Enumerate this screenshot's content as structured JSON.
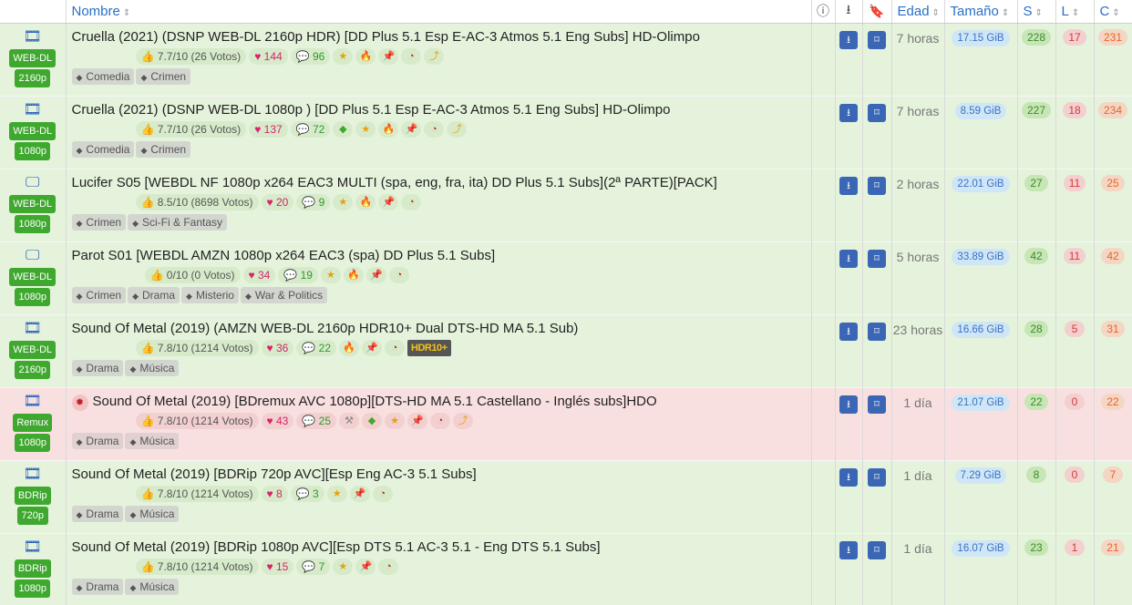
{
  "header": {
    "nombre": "Nombre",
    "edad": "Edad",
    "tamano": "Tamaño",
    "s": "S",
    "l": "L",
    "c": "C",
    "info_icon": "info-icon",
    "download_icon": "download-icon",
    "bookmark_icon": "bookmark-icon",
    "sort_icon": "sort-icon"
  },
  "colors": {
    "row_green": "#e5f3dc",
    "row_red": "#f9e0e0",
    "badge_green": "#3fa82f",
    "button_blue": "#3a66b5",
    "link_blue": "#2a6fc9"
  },
  "rows": [
    {
      "type_icon": "film-icon",
      "badge1": "WEB-DL",
      "badge2": "2160p",
      "title": "Cruella (2021) (DSNP WEB-DL 2160p HDR) [DD Plus 5.1 Esp E-AC-3 Atmos 5.1 Eng Subs] HD-Olimpo",
      "rating": "7.7/10 (26 Votos)",
      "likes": "144",
      "comments": "96",
      "icons": [
        "star-icon",
        "fire-icon",
        "pin-icon",
        "gauge-icon",
        "quick-icon"
      ],
      "tags": [
        "Comedia",
        "Crimen"
      ],
      "age": "7 horas",
      "size": "17.15 GiB",
      "seeders": "228",
      "leechers": "17",
      "completed": "231"
    },
    {
      "type_icon": "film-icon",
      "badge1": "WEB-DL",
      "badge2": "1080p",
      "title": "Cruella (2021) (DSNP WEB-DL 1080p ) [DD Plus 5.1 Esp E-AC-3 Atmos 5.1 Eng Subs] HD-Olimpo",
      "rating": "7.7/10 (26 Votos)",
      "likes": "137",
      "comments": "72",
      "icons": [
        "gem-icon",
        "star-icon",
        "fire-icon",
        "pin-icon",
        "gauge-icon",
        "quick-icon"
      ],
      "tags": [
        "Comedia",
        "Crimen"
      ],
      "age": "7 horas",
      "size": "8.59 GiB",
      "seeders": "227",
      "leechers": "18",
      "completed": "234"
    },
    {
      "type_icon": "tv-icon",
      "badge1": "WEB-DL",
      "badge2": "1080p",
      "title": "Lucifer S05 [WEBDL NF 1080p x264 EAC3 MULTI (spa, eng, fra, ita) DD Plus 5.1 Subs](2ª PARTE)[PACK]",
      "rating": "8.5/10 (8698 Votos)",
      "likes": "20",
      "comments": "9",
      "icons": [
        "star-icon",
        "fire-icon",
        "pin-icon",
        "gauge-icon"
      ],
      "tags": [
        "Crimen",
        "Sci-Fi & Fantasy"
      ],
      "age": "2 horas",
      "size": "22.01 GiB",
      "seeders": "27",
      "leechers": "11",
      "completed": "25"
    },
    {
      "type_icon": "tv-icon",
      "badge1": "WEB-DL",
      "badge2": "1080p",
      "title": "Parot S01 [WEBDL AMZN 1080p x264 EAC3 (spa) DD Plus 5.1 Subs]",
      "rating": "0/10 (0 Votos)",
      "likes": "34",
      "comments": "19",
      "icons": [
        "star-icon",
        "fire-icon",
        "pin-icon",
        "gauge-icon"
      ],
      "tags": [
        "Crimen",
        "Drama",
        "Misterio",
        "War & Politics"
      ],
      "age": "5 horas",
      "size": "33.89 GiB",
      "seeders": "42",
      "leechers": "11",
      "completed": "42"
    },
    {
      "type_icon": "film-icon",
      "badge1": "WEB-DL",
      "badge2": "2160p",
      "title": "Sound Of Metal (2019) (AMZN WEB-DL 2160p HDR10+ Dual DTS-HD MA 5.1 Sub)",
      "rating": "7.8/10 (1214 Votos)",
      "likes": "36",
      "comments": "22",
      "icons": [
        "fire-icon",
        "pin-icon",
        "gauge-icon"
      ],
      "hdr_label": "HDR10+",
      "tags": [
        "Drama",
        "Música"
      ],
      "age": "23 horas",
      "size": "16.66 GiB",
      "seeders": "28",
      "leechers": "5",
      "completed": "31"
    },
    {
      "type_icon": "film-icon",
      "badge1": "Remux",
      "badge2": "1080p",
      "warning_icon": "virus-icon",
      "title": "Sound Of Metal (2019) [BDremux AVC 1080p][DTS-HD MA 5.1 Castellano - Inglés subs]HDO",
      "rating": "7.8/10 (1214 Votos)",
      "likes": "43",
      "comments": "25",
      "icons": [
        "tools-icon",
        "gem-icon",
        "star-icon",
        "pin-icon",
        "gauge-icon",
        "quick-icon"
      ],
      "tags": [
        "Drama",
        "Música"
      ],
      "age": "1 día",
      "size": "21.07 GiB",
      "seeders": "22",
      "leechers": "0",
      "completed": "22"
    },
    {
      "type_icon": "film-icon",
      "badge1": "BDRip",
      "badge2": "720p",
      "title": "Sound Of Metal (2019) [BDRip 720p AVC][Esp Eng AC-3 5.1 Subs]",
      "rating": "7.8/10 (1214 Votos)",
      "likes": "8",
      "comments": "3",
      "icons": [
        "star-icon",
        "pin-icon",
        "gauge-icon"
      ],
      "tags": [
        "Drama",
        "Música"
      ],
      "age": "1 día",
      "size": "7.29 GiB",
      "seeders": "8",
      "leechers": "0",
      "completed": "7"
    },
    {
      "type_icon": "film-icon",
      "badge1": "BDRip",
      "badge2": "1080p",
      "title": "Sound Of Metal (2019) [BDRip 1080p AVC][Esp DTS 5.1 AC-3 5.1 - Eng DTS 5.1 Subs]",
      "rating": "7.8/10 (1214 Votos)",
      "likes": "15",
      "comments": "7",
      "icons": [
        "star-icon",
        "pin-icon",
        "gauge-icon"
      ],
      "tags": [
        "Drama",
        "Música"
      ],
      "age": "1 día",
      "size": "16.07 GiB",
      "seeders": "23",
      "leechers": "1",
      "completed": "21"
    }
  ]
}
